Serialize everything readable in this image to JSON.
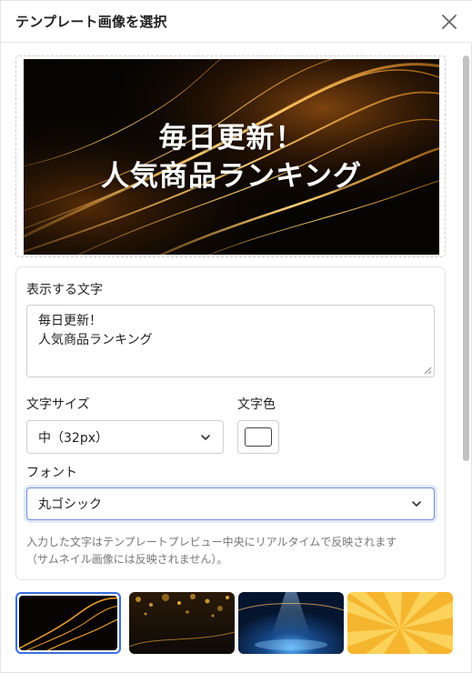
{
  "dialog": {
    "title": "テンプレート画像を選択"
  },
  "preview": {
    "lines": [
      "毎日更新！",
      "人気商品ランキング"
    ]
  },
  "form": {
    "text_label": "表示する文字",
    "text_value_lines": [
      "毎日更新！",
      "人気商品ランキング"
    ],
    "size_label": "文字サイズ",
    "size_value": "中（32px）",
    "color_label": "文字色",
    "text_color": "#ffffff",
    "font_label": "フォント",
    "font_value": "丸ゴシック",
    "help_lines": [
      "入力した文字はテンプレートプレビュー中央にリアルタイムで反映されます",
      "（サムネイル画像には反映されません）。"
    ]
  },
  "thumbnails": [
    {
      "style": "gold-waves",
      "selected": true
    },
    {
      "style": "gold-bokeh",
      "selected": false
    },
    {
      "style": "blue-stage",
      "selected": false
    },
    {
      "style": "yellow-sunburst",
      "selected": false
    }
  ],
  "colors": {
    "accent": "#3d6fe0",
    "gold": "#f0a030"
  }
}
